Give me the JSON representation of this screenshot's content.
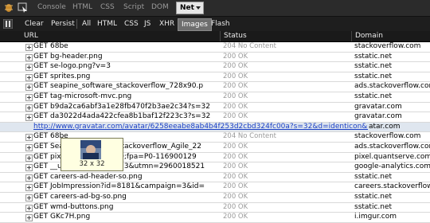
{
  "top_tabs": [
    "Console",
    "HTML",
    "CSS",
    "Script",
    "DOM",
    "Net"
  ],
  "active_top_tab": "Net",
  "filters": [
    "Clear",
    "Persist",
    "All",
    "HTML",
    "CSS",
    "JS",
    "XHR",
    "Images",
    "Flash"
  ],
  "active_filter": "Images",
  "columns": {
    "url": "URL",
    "status": "Status",
    "domain": "Domain"
  },
  "rows": [
    {
      "url": "GET 68be",
      "status": "204 No Content",
      "domain": "stackoverflow.com"
    },
    {
      "url": "GET bg-header.png",
      "status": "200 OK",
      "domain": "sstatic.net"
    },
    {
      "url": "GET se-logo.png?v=3",
      "status": "200 OK",
      "domain": "sstatic.net"
    },
    {
      "url": "GET sprites.png",
      "status": "200 OK",
      "domain": "sstatic.net"
    },
    {
      "url": "GET seapine_software_stackoverflow_728x90.p",
      "status": "200 OK",
      "domain": "ads.stackoverflow.com"
    },
    {
      "url": "GET tag-microsoft-mvc.png",
      "status": "200 OK",
      "domain": "sstatic.net"
    },
    {
      "url": "GET b9da2ca6abf3a1e28fb470f2b3ae2c34?s=32",
      "status": "200 OK",
      "domain": "gravatar.com"
    },
    {
      "url": "GET da3022d4ada422cfea8b1baf12f223c3?s=32",
      "status": "200 OK",
      "domain": "gravatar.com"
    },
    {
      "url": "http://www.gravatar.com/avatar/6258eeabe8ab4b4f253d2cbd324fc00a?s=32&d=identicon&r=PG",
      "status": "",
      "domain": "atar.com",
      "highlight": true
    },
    {
      "url": "GET 68be",
      "status": "204 No Content",
      "domain": "stackoverflow.com"
    },
    {
      "url": "GET Seapine_Software_stackoverflow_Agile_22",
      "status": "200 OK",
      "domain": "ads.stackoverflow.com"
    },
    {
      "url": "GET pixel;r=1238594040;fpa=P0-116900129",
      "status": "200 OK",
      "domain": "pixel.quantserve.com"
    },
    {
      "url": "GET __utm.gif?utmwv=4.3&utmn=2960018521",
      "status": "200 OK",
      "domain": "google-analytics.com"
    },
    {
      "url": "GET careers-ad-header-so.png",
      "status": "200 OK",
      "domain": "sstatic.net"
    },
    {
      "url": "GET JobImpression?id=8181&campaign=3&id=",
      "status": "200 OK",
      "domain": "careers.stackoverflow.com"
    },
    {
      "url": "GET careers-ad-bg-so.png",
      "status": "200 OK",
      "domain": "sstatic.net"
    },
    {
      "url": "GET wmd-buttons.png",
      "status": "200 OK",
      "domain": "sstatic.net"
    },
    {
      "url": "GET GKc7H.png",
      "status": "200 OK",
      "domain": "i.imgur.com"
    }
  ],
  "tooltip": {
    "size_label": "32 x 32"
  }
}
